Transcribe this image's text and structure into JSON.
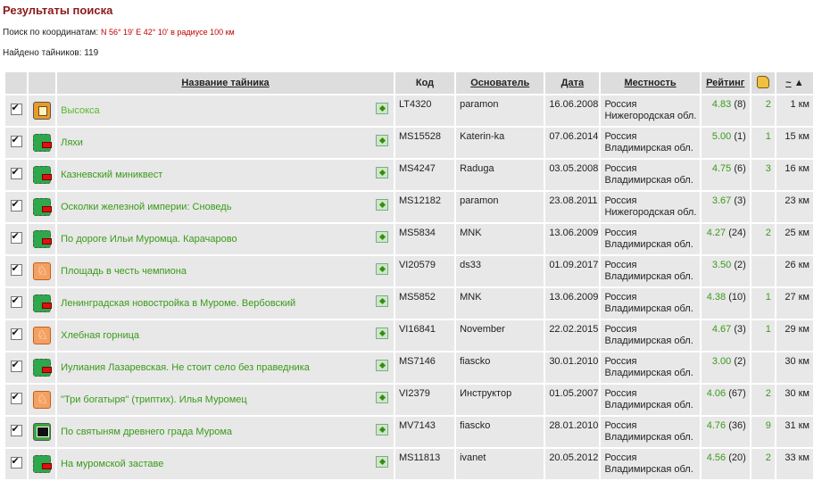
{
  "header": {
    "title": "Результаты поиска",
    "coords_label": "Поиск по координатам:",
    "coords_value": "N 56° 19' E 42° 10' в радиусе 100 км",
    "found_label": "Найдено тайников:",
    "found_count": "119"
  },
  "columns": {
    "name": "Название тайника",
    "code": "Код",
    "owner": "Основатель",
    "date": "Дата",
    "location": "Местность",
    "rating": "Рейтинг",
    "recommend_icon": "thumbs-up-icon",
    "distance": "~",
    "sort_arrow": "▲"
  },
  "rows": [
    {
      "icon": "trad",
      "name": "Высокса",
      "code": "LT4320",
      "owner": "paramon",
      "date": "16.06.2008",
      "country": "Россия",
      "region": "Нижегородская обл.",
      "rating": "4.83",
      "votes": "(8)",
      "rec": "2",
      "dist": "1 км"
    },
    {
      "icon": "multi",
      "name": "Ляхи",
      "code": "MS15528",
      "owner": "Katerin-ka",
      "date": "07.06.2014",
      "country": "Россия",
      "region": "Владимирская обл.",
      "rating": "5.00",
      "votes": "(1)",
      "rec": "1",
      "dist": "15 км"
    },
    {
      "icon": "multi",
      "name": "Казневский миниквест",
      "code": "MS4247",
      "owner": "Raduga",
      "date": "03.05.2008",
      "country": "Россия",
      "region": "Владимирская обл.",
      "rating": "4.75",
      "votes": "(6)",
      "rec": "3",
      "dist": "16 км"
    },
    {
      "icon": "multi",
      "name": "Осколки железной империи: Сноведь",
      "code": "MS12182",
      "owner": "paramon",
      "date": "23.08.2011",
      "country": "Россия",
      "region": "Нижегородская обл.",
      "rating": "3.67",
      "votes": "(3)",
      "rec": "",
      "dist": "23 км"
    },
    {
      "icon": "multi",
      "name": "По дороге Ильи Муромца. Карачарово",
      "code": "MS5834",
      "owner": "MNK",
      "date": "13.06.2009",
      "country": "Россия",
      "region": "Владимирская обл.",
      "rating": "4.27",
      "votes": "(24)",
      "rec": "2",
      "dist": "25 км"
    },
    {
      "icon": "virtual",
      "name": "Площадь в честь чемпиона",
      "code": "VI20579",
      "owner": "ds33",
      "date": "01.09.2017",
      "country": "Россия",
      "region": "Владимирская обл.",
      "rating": "3.50",
      "votes": "(2)",
      "rec": "",
      "dist": "26 км"
    },
    {
      "icon": "multi",
      "name": "Ленинградская новостройка в Муроме. Вербовский",
      "code": "MS5852",
      "owner": "MNK",
      "date": "13.06.2009",
      "country": "Россия",
      "region": "Владимирская обл.",
      "rating": "4.38",
      "votes": "(10)",
      "rec": "1",
      "dist": "27 км"
    },
    {
      "icon": "virtual",
      "name": "Хлебная горница",
      "code": "VI16841",
      "owner": "November",
      "date": "22.02.2015",
      "country": "Россия",
      "region": "Владимирская обл.",
      "rating": "4.67",
      "votes": "(3)",
      "rec": "1",
      "dist": "29 км"
    },
    {
      "icon": "multi",
      "name": "Иулиания Лазаревская. Не стоит село без праведника",
      "code": "MS7146",
      "owner": "fiascko",
      "date": "30.01.2010",
      "country": "Россия",
      "region": "Владимирская обл.",
      "rating": "3.00",
      "votes": "(2)",
      "rec": "",
      "dist": "30 км"
    },
    {
      "icon": "virtual",
      "name": "\"Три богатыря\" (триптих). Илья Муромец",
      "code": "VI2379",
      "owner": "Инструктор",
      "date": "01.05.2007",
      "country": "Россия",
      "region": "Владимирская обл.",
      "rating": "4.06",
      "votes": "(67)",
      "rec": "2",
      "dist": "30 км"
    },
    {
      "icon": "event",
      "name": "По святыням древнего града Мурома",
      "code": "MV7143",
      "owner": "fiascko",
      "date": "28.01.2010",
      "country": "Россия",
      "region": "Владимирская обл.",
      "rating": "4.76",
      "votes": "(36)",
      "rec": "9",
      "dist": "31 км"
    },
    {
      "icon": "multi",
      "name": "На муромской заставе",
      "code": "MS11813",
      "owner": "ivanet",
      "date": "20.05.2012",
      "country": "Россия",
      "region": "Владимирская обл.",
      "rating": "4.56",
      "votes": "(20)",
      "rec": "2",
      "dist": "33 км"
    }
  ]
}
